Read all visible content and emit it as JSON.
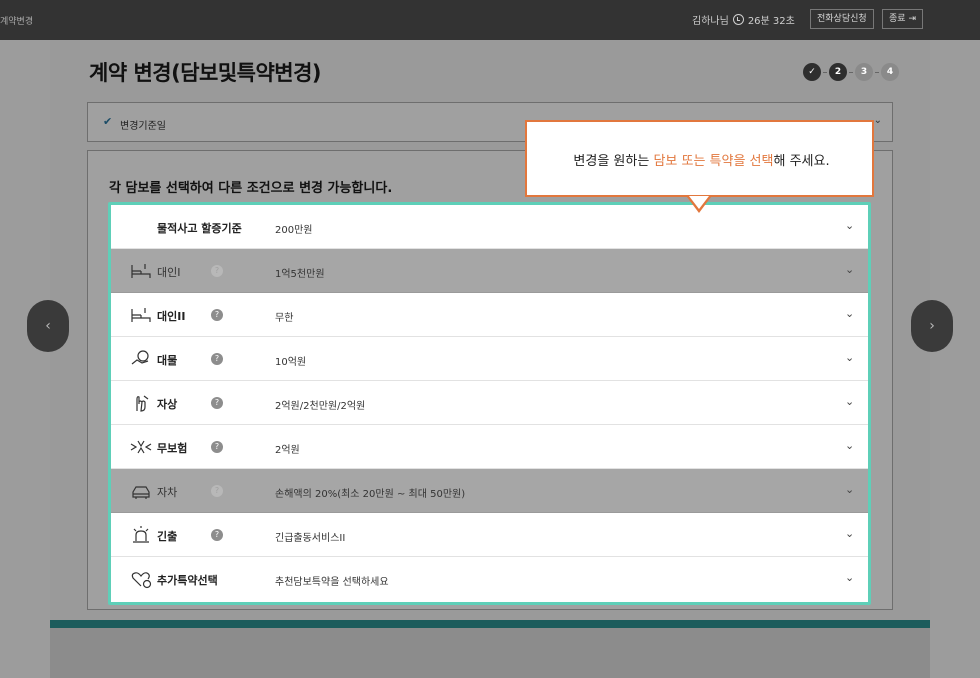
{
  "header": {
    "app_title": "계약변경",
    "user_name": "김하나님",
    "timer": "26분 32초",
    "consult_button": "전화상담신청",
    "exit_button": "종료"
  },
  "page": {
    "title": "계약 변경(담보및특약변경)",
    "steps": [
      "✓",
      "2",
      "3",
      "4"
    ],
    "accordion_label": "변경기준일",
    "content_title": "각 담보를 선택하여 다른 조건으로 변경 가능합니다."
  },
  "tooltip": {
    "prefix": "변경을 원하는 ",
    "highlight": "담보 또는 특약을 선택",
    "suffix": "해 주세요."
  },
  "rows": [
    {
      "name": "물적사고 할증기준",
      "value": "200만원",
      "dim": false,
      "help": false,
      "icon": "none"
    },
    {
      "name": "대인I",
      "value": "1억5천만원",
      "dim": true,
      "help": true,
      "icon": "bed-icon"
    },
    {
      "name": "대인II",
      "value": "무한",
      "dim": false,
      "help": true,
      "icon": "bed-icon"
    },
    {
      "name": "대물",
      "value": "10억원",
      "dim": false,
      "help": true,
      "icon": "coin-hand-icon"
    },
    {
      "name": "자상",
      "value": "2억원/2천만원/2억원",
      "dim": false,
      "help": true,
      "icon": "injury-hand-icon"
    },
    {
      "name": "무보험",
      "value": "2억원",
      "dim": false,
      "help": true,
      "icon": "crash-icon"
    },
    {
      "name": "자차",
      "value": "손해액의 20%(최소 20만원 ~ 최대 50만원)",
      "dim": true,
      "help": true,
      "icon": "car-icon"
    },
    {
      "name": "긴출",
      "value": "긴급출동서비스II",
      "dim": false,
      "help": true,
      "icon": "siren-icon"
    },
    {
      "name": "추가특약선택",
      "value": "추천담보특약을 선택하세요",
      "dim": false,
      "help": false,
      "icon": "heart-plus-icon"
    }
  ],
  "colors": {
    "accent_orange": "#e2773d",
    "highlight_teal": "#5ecfb8",
    "topbar": "#333333"
  }
}
